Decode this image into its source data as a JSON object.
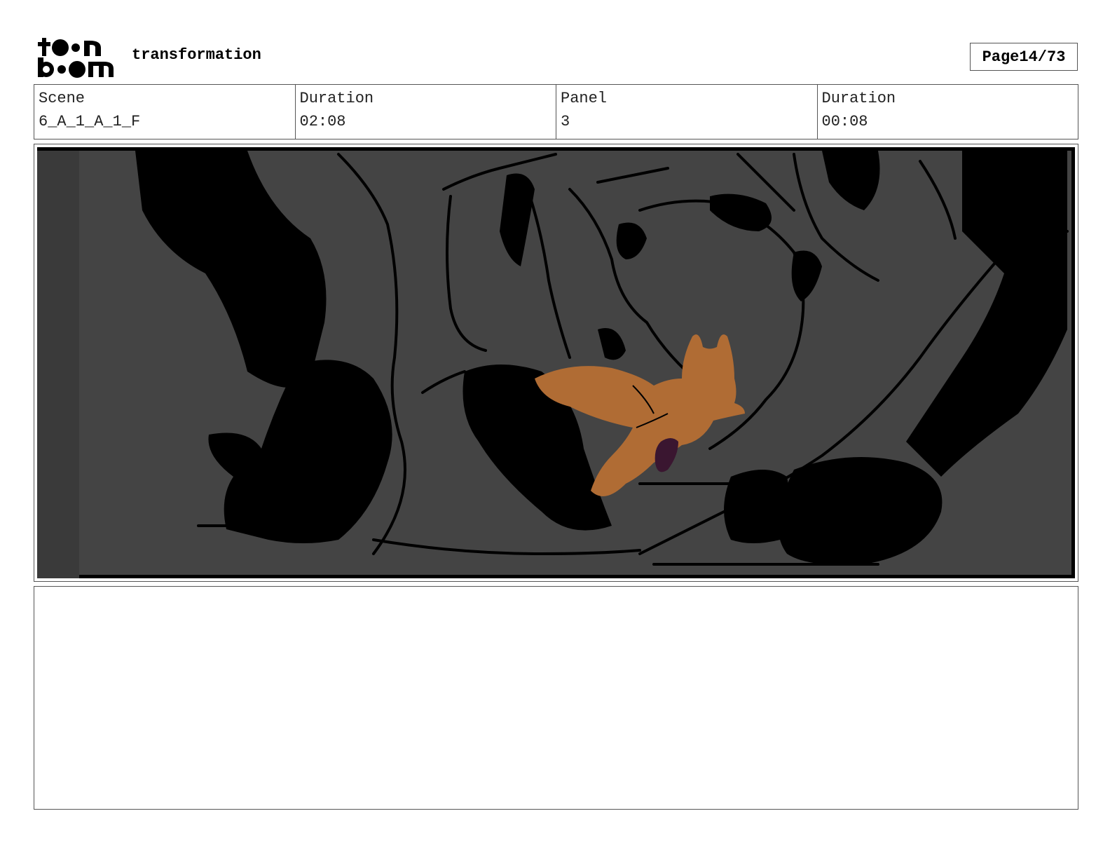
{
  "header": {
    "logo_name": "toon boom",
    "project_title": "transformation",
    "page_label": "Page",
    "page_current": "14",
    "page_total": "73"
  },
  "info": [
    {
      "label": "Scene",
      "value": "6_A_1_A_1_F"
    },
    {
      "label": "Duration",
      "value": "02:08"
    },
    {
      "label": "Panel",
      "value": "3"
    },
    {
      "label": "Duration",
      "value": "00:08"
    }
  ],
  "panel": {
    "colors": {
      "background": "#444444",
      "rock_shadow": "#000000",
      "fox_fur": "#b06c34",
      "fox_accent": "#3a1630"
    }
  },
  "notes": {
    "text": ""
  }
}
